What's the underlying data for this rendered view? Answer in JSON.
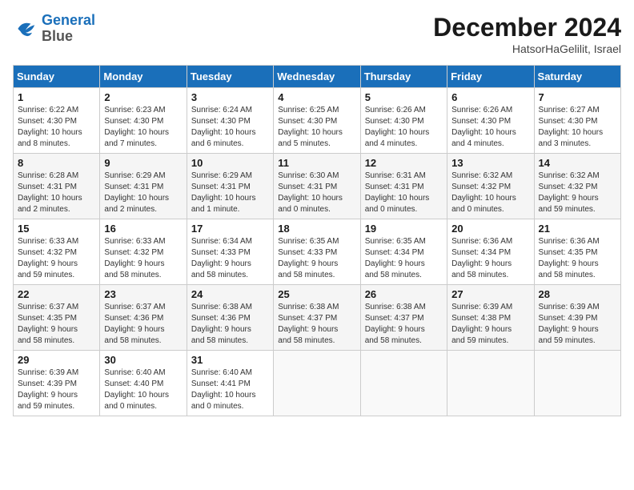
{
  "header": {
    "logo_line1": "General",
    "logo_line2": "Blue",
    "month": "December 2024",
    "location": "HatsorHaGelilit, Israel"
  },
  "weekdays": [
    "Sunday",
    "Monday",
    "Tuesday",
    "Wednesday",
    "Thursday",
    "Friday",
    "Saturday"
  ],
  "weeks": [
    [
      {
        "day": "1",
        "info": "Sunrise: 6:22 AM\nSunset: 4:30 PM\nDaylight: 10 hours\nand 8 minutes."
      },
      {
        "day": "2",
        "info": "Sunrise: 6:23 AM\nSunset: 4:30 PM\nDaylight: 10 hours\nand 7 minutes."
      },
      {
        "day": "3",
        "info": "Sunrise: 6:24 AM\nSunset: 4:30 PM\nDaylight: 10 hours\nand 6 minutes."
      },
      {
        "day": "4",
        "info": "Sunrise: 6:25 AM\nSunset: 4:30 PM\nDaylight: 10 hours\nand 5 minutes."
      },
      {
        "day": "5",
        "info": "Sunrise: 6:26 AM\nSunset: 4:30 PM\nDaylight: 10 hours\nand 4 minutes."
      },
      {
        "day": "6",
        "info": "Sunrise: 6:26 AM\nSunset: 4:30 PM\nDaylight: 10 hours\nand 4 minutes."
      },
      {
        "day": "7",
        "info": "Sunrise: 6:27 AM\nSunset: 4:30 PM\nDaylight: 10 hours\nand 3 minutes."
      }
    ],
    [
      {
        "day": "8",
        "info": "Sunrise: 6:28 AM\nSunset: 4:31 PM\nDaylight: 10 hours\nand 2 minutes."
      },
      {
        "day": "9",
        "info": "Sunrise: 6:29 AM\nSunset: 4:31 PM\nDaylight: 10 hours\nand 2 minutes."
      },
      {
        "day": "10",
        "info": "Sunrise: 6:29 AM\nSunset: 4:31 PM\nDaylight: 10 hours\nand 1 minute."
      },
      {
        "day": "11",
        "info": "Sunrise: 6:30 AM\nSunset: 4:31 PM\nDaylight: 10 hours\nand 0 minutes."
      },
      {
        "day": "12",
        "info": "Sunrise: 6:31 AM\nSunset: 4:31 PM\nDaylight: 10 hours\nand 0 minutes."
      },
      {
        "day": "13",
        "info": "Sunrise: 6:32 AM\nSunset: 4:32 PM\nDaylight: 10 hours\nand 0 minutes."
      },
      {
        "day": "14",
        "info": "Sunrise: 6:32 AM\nSunset: 4:32 PM\nDaylight: 9 hours\nand 59 minutes."
      }
    ],
    [
      {
        "day": "15",
        "info": "Sunrise: 6:33 AM\nSunset: 4:32 PM\nDaylight: 9 hours\nand 59 minutes."
      },
      {
        "day": "16",
        "info": "Sunrise: 6:33 AM\nSunset: 4:32 PM\nDaylight: 9 hours\nand 58 minutes."
      },
      {
        "day": "17",
        "info": "Sunrise: 6:34 AM\nSunset: 4:33 PM\nDaylight: 9 hours\nand 58 minutes."
      },
      {
        "day": "18",
        "info": "Sunrise: 6:35 AM\nSunset: 4:33 PM\nDaylight: 9 hours\nand 58 minutes."
      },
      {
        "day": "19",
        "info": "Sunrise: 6:35 AM\nSunset: 4:34 PM\nDaylight: 9 hours\nand 58 minutes."
      },
      {
        "day": "20",
        "info": "Sunrise: 6:36 AM\nSunset: 4:34 PM\nDaylight: 9 hours\nand 58 minutes."
      },
      {
        "day": "21",
        "info": "Sunrise: 6:36 AM\nSunset: 4:35 PM\nDaylight: 9 hours\nand 58 minutes."
      }
    ],
    [
      {
        "day": "22",
        "info": "Sunrise: 6:37 AM\nSunset: 4:35 PM\nDaylight: 9 hours\nand 58 minutes."
      },
      {
        "day": "23",
        "info": "Sunrise: 6:37 AM\nSunset: 4:36 PM\nDaylight: 9 hours\nand 58 minutes."
      },
      {
        "day": "24",
        "info": "Sunrise: 6:38 AM\nSunset: 4:36 PM\nDaylight: 9 hours\nand 58 minutes."
      },
      {
        "day": "25",
        "info": "Sunrise: 6:38 AM\nSunset: 4:37 PM\nDaylight: 9 hours\nand 58 minutes."
      },
      {
        "day": "26",
        "info": "Sunrise: 6:38 AM\nSunset: 4:37 PM\nDaylight: 9 hours\nand 58 minutes."
      },
      {
        "day": "27",
        "info": "Sunrise: 6:39 AM\nSunset: 4:38 PM\nDaylight: 9 hours\nand 59 minutes."
      },
      {
        "day": "28",
        "info": "Sunrise: 6:39 AM\nSunset: 4:39 PM\nDaylight: 9 hours\nand 59 minutes."
      }
    ],
    [
      {
        "day": "29",
        "info": "Sunrise: 6:39 AM\nSunset: 4:39 PM\nDaylight: 9 hours\nand 59 minutes."
      },
      {
        "day": "30",
        "info": "Sunrise: 6:40 AM\nSunset: 4:40 PM\nDaylight: 10 hours\nand 0 minutes."
      },
      {
        "day": "31",
        "info": "Sunrise: 6:40 AM\nSunset: 4:41 PM\nDaylight: 10 hours\nand 0 minutes."
      },
      {
        "day": "",
        "info": ""
      },
      {
        "day": "",
        "info": ""
      },
      {
        "day": "",
        "info": ""
      },
      {
        "day": "",
        "info": ""
      }
    ]
  ]
}
